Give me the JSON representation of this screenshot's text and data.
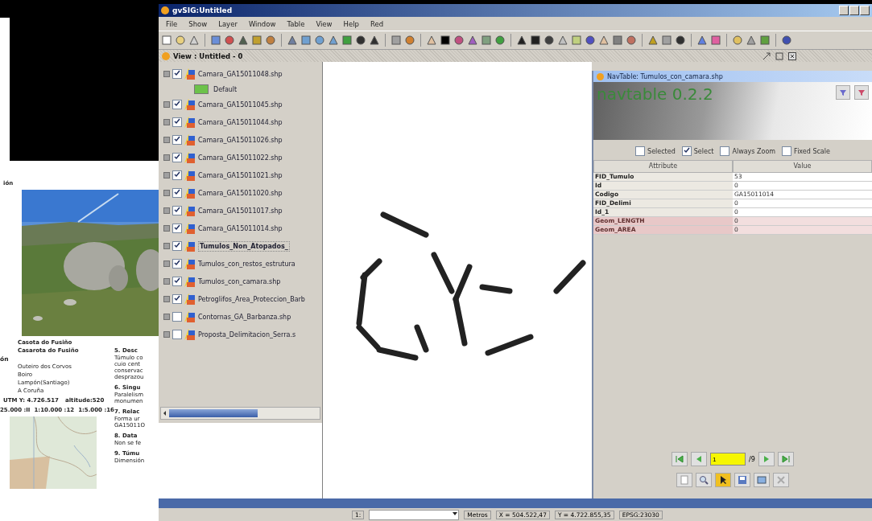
{
  "document": {
    "heading": "ión",
    "photo": {
      "kind": "picture"
    },
    "captions": [
      "Casota do Fusiño",
      "Casarota do Fusiño"
    ],
    "location_heading": "ón",
    "location_lines": [
      "Outeiro dos Corvos",
      "Boiro",
      "Lampón(Santiago)",
      "A Coruña"
    ],
    "coordinates": [
      "UTM Y: 4.726.517",
      "altitude:520"
    ],
    "scales": [
      "25.000 :II",
      "1:10.000 :12",
      "1:5.000 :16"
    ],
    "map": {
      "kind": "picture"
    },
    "sections": [
      {
        "title": "5. Desc",
        "lines": [
          "Túmulo co",
          "cuio cent",
          "conservac",
          "desprazou"
        ]
      },
      {
        "title": "6. Singu",
        "lines": [
          "Paralelism",
          "monumen"
        ]
      },
      {
        "title": "7. Relac",
        "lines": [
          "Forma ur",
          "GA15011O"
        ]
      },
      {
        "title": "8. Data",
        "lines": [
          "Non se fe"
        ]
      },
      {
        "title": "9. Túmu",
        "lines": [
          "Dimensión"
        ]
      }
    ]
  },
  "window": {
    "title": "gvSIG:Untitled"
  },
  "menu": [
    "File",
    "Show",
    "Layer",
    "Window",
    "Table",
    "View",
    "Help",
    "Red"
  ],
  "view": {
    "title": "View : Untitled - 0"
  },
  "layers": [
    {
      "name": "Camara_GA15011048.shp",
      "checked": true,
      "kind": "layer",
      "children": [
        {
          "name": "Default",
          "kind": "legend",
          "color": "#6cc24a"
        }
      ]
    },
    {
      "name": "Camara_GA15011045.shp",
      "checked": true,
      "kind": "layer"
    },
    {
      "name": "Camara_GA15011044.shp",
      "checked": true,
      "kind": "layer"
    },
    {
      "name": "Camara_GA15011026.shp",
      "checked": true,
      "kind": "layer"
    },
    {
      "name": "Camara_GA15011022.shp",
      "checked": true,
      "kind": "layer"
    },
    {
      "name": "Camara_GA15011021.shp",
      "checked": true,
      "kind": "layer"
    },
    {
      "name": "Camara_GA15011020.shp",
      "checked": true,
      "kind": "layer"
    },
    {
      "name": "Camara_GA15011017.shp",
      "checked": true,
      "kind": "layer"
    },
    {
      "name": "Camara_GA15011014.shp",
      "checked": true,
      "kind": "layer"
    },
    {
      "name": "Tumulos_Non_Atopados_",
      "checked": true,
      "kind": "layer",
      "selected": true
    },
    {
      "name": "Tumulos_con_restos_estrutura",
      "checked": true,
      "kind": "layer"
    },
    {
      "name": "Tumulos_con_camara.shp",
      "checked": true,
      "kind": "layer"
    },
    {
      "name": "Petroglifos_Area_Proteccion_Barb",
      "checked": true,
      "kind": "layer"
    },
    {
      "name": "Contornas_GA_Barbanza.shp",
      "checked": false,
      "kind": "layer"
    },
    {
      "name": "Proposta_Delimitacion_Serra.s",
      "checked": false,
      "kind": "layer"
    }
  ],
  "navtable": {
    "title": "NavTable: Tumulos_con_camara.shp",
    "logo": "navtable 0.2.2",
    "options": [
      {
        "label": "Selected",
        "checked": false
      },
      {
        "label": "Select",
        "checked": true
      },
      {
        "label": "Always Zoom",
        "checked": false
      },
      {
        "label": "Fixed Scale",
        "checked": false
      }
    ],
    "columns": [
      "Attribute",
      "Value"
    ],
    "rows": [
      {
        "attribute": "FID_Tumulo",
        "value": "53",
        "geometry": false
      },
      {
        "attribute": "Id",
        "value": "0",
        "geometry": false
      },
      {
        "attribute": "Codigo",
        "value": "GA15011014",
        "geometry": false
      },
      {
        "attribute": "FID_Delimi",
        "value": "0",
        "geometry": false
      },
      {
        "attribute": "Id_1",
        "value": "0",
        "geometry": false
      },
      {
        "attribute": "Geom_LENGTH",
        "value": "0",
        "geometry": true
      },
      {
        "attribute": "Geom_AREA",
        "value": "0",
        "geometry": true
      }
    ],
    "record": "1",
    "total": "/9"
  },
  "status_bar": {
    "scale_label": "1:",
    "units": "Metros",
    "x": "X = 504.522,47",
    "y": "Y = 4.722.855,35",
    "crs": "EPSG:23030"
  }
}
